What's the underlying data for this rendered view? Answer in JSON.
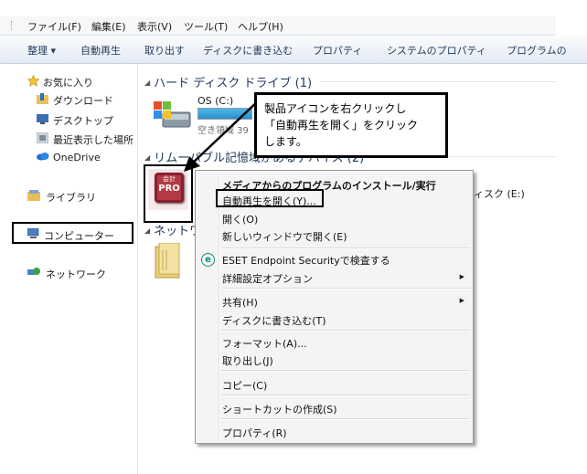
{
  "menubar": [
    "ファイル(F)",
    "編集(E)",
    "表示(V)",
    "ツール(T)",
    "ヘルプ(H)"
  ],
  "toolbar": {
    "organize": "整理 ▾",
    "autoplay": "自動再生",
    "eject": "取り出す",
    "burn": "ディスクに書き込む",
    "properties": "プロパティ",
    "system_properties": "システムのプロパティ",
    "programs": "プログラムの"
  },
  "nav": {
    "favorites": "お気に入り",
    "downloads": "ダウンロード",
    "desktop": "デスクトップ",
    "recent": "最近表示した場所",
    "onedrive": "OneDrive",
    "libraries": "ライブラリ",
    "computer": "コンピューター",
    "network": "ネットワーク"
  },
  "content": {
    "hdd_group": "ハード ディスク ドライブ (1)",
    "os_drive": "OS (C:)",
    "os_free": "空き領域 39",
    "removable_group": "リムーバブル記憶域があるデバイス (2)",
    "network_group": "ネットワーク",
    "drive_e": "ィスク (E:)",
    "product_icon": {
      "line1": "会計",
      "line2": "PRO",
      "color": "#8b1e2e"
    }
  },
  "callout": {
    "lines": [
      "製品アイコンを右クリックし",
      "「自動再生を開く」をクリック",
      "します。"
    ]
  },
  "context_menu": {
    "install": "メディアからのプログラムのインストール/実行",
    "autoplay_open": "自動再生を開く(Y)...",
    "open": "開く(O)",
    "open_new_window": "新しいウィンドウで開く(E)",
    "eset_scan": "ESET Endpoint Securityで検査する",
    "advanced": "詳細設定オプション",
    "share": "共有(H)",
    "burn": "ディスクに書き込む(T)",
    "format": "フォーマット(A)...",
    "eject": "取り出し(J)",
    "copy": "コピー(C)",
    "shortcut": "ショートカットの作成(S)",
    "properties": "プロパティ(R)"
  }
}
